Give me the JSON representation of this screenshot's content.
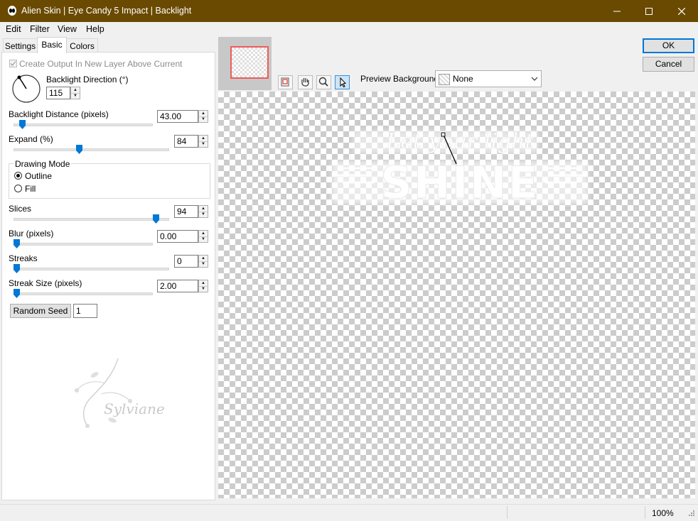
{
  "window": {
    "title": "Alien Skin | Eye Candy 5 Impact | Backlight",
    "minimize_icon": "minimize-icon",
    "maximize_icon": "maximize-icon",
    "close_icon": "close-icon"
  },
  "menu": {
    "items": [
      "Edit",
      "Filter",
      "View",
      "Help"
    ]
  },
  "tabs": {
    "items": [
      "Settings",
      "Basic",
      "Colors"
    ],
    "active": "Basic"
  },
  "basic": {
    "create_output_label": "Create Output In New Layer Above Current",
    "create_output_checked": true,
    "backlight_direction_label": "Backlight Direction (°)",
    "backlight_direction_value": "115",
    "backlight_distance_label": "Backlight Distance (pixels)",
    "backlight_distance_value": "43.00",
    "expand_label": "Expand (%)",
    "expand_value": "84",
    "drawing_mode_label": "Drawing Mode",
    "outline_label": "Outline",
    "fill_label": "Fill",
    "drawing_mode_selected": "Outline",
    "slices_label": "Slices",
    "slices_value": "94",
    "blur_label": "Blur (pixels)",
    "blur_value": "0.00",
    "streaks_label": "Streaks",
    "streaks_value": "0",
    "streak_size_label": "Streak Size (pixels)",
    "streak_size_value": "2.00",
    "random_seed_button": "Random Seed",
    "random_seed_value": "1"
  },
  "preview": {
    "background_label": "Preview Background:",
    "background_value": "None",
    "tools": [
      "navigator-icon",
      "hand-icon",
      "zoom-icon",
      "pointer-icon"
    ],
    "active_tool": "pointer-icon",
    "text_small": "Let your light",
    "text_large": "SHINE"
  },
  "actions": {
    "ok": "OK",
    "cancel": "Cancel"
  },
  "watermark": {
    "signature": "Sylviane"
  },
  "status": {
    "zoom": "100%"
  },
  "colors": {
    "titlebar": "#6a4a00",
    "accent": "#0078d7",
    "nav_frame": "#ef5b5b"
  }
}
